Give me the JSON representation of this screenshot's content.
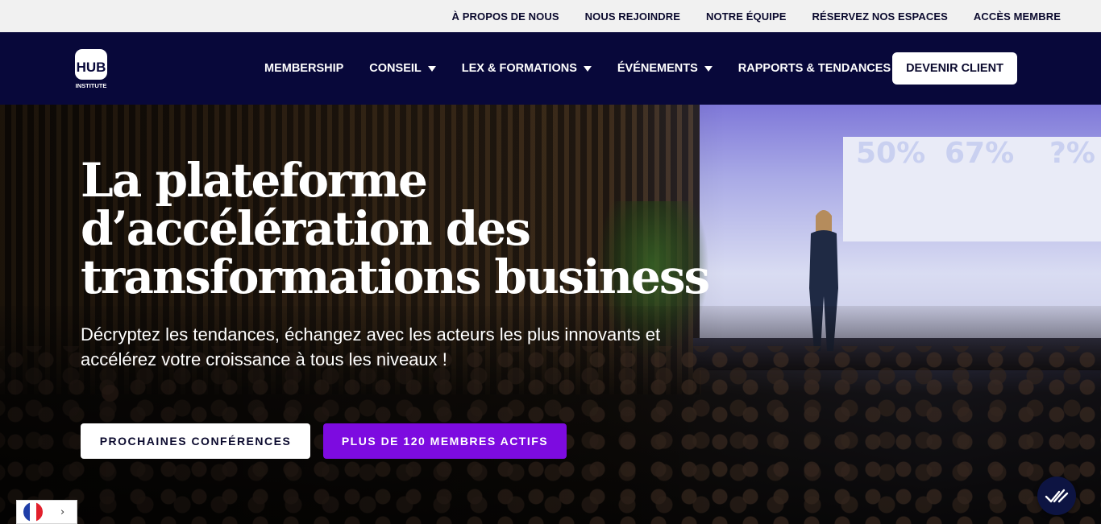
{
  "topbar": {
    "links": [
      "À PROPOS DE NOUS",
      "NOUS REJOINDRE",
      "NOTRE ÉQUIPE",
      "RÉSERVEZ NOS ESPACES",
      "ACCÈS MEMBRE"
    ]
  },
  "logo": {
    "text": "HUB",
    "subtext": "INSTITUTE",
    "icon": "hub-institute-logo"
  },
  "nav": {
    "items": [
      {
        "label": "MEMBERSHIP",
        "dropdown": false
      },
      {
        "label": "CONSEIL",
        "dropdown": true
      },
      {
        "label": "LEX & FORMATIONS",
        "dropdown": true
      },
      {
        "label": "ÉVÉNEMENTS",
        "dropdown": true
      },
      {
        "label": "RAPPORTS & TENDANCES",
        "dropdown": true
      }
    ],
    "cta": "DEVENIR CLIENT"
  },
  "hero": {
    "headline_line1": "La plateforme",
    "headline_line2": "d’accélération des",
    "headline_line3": "transformations business",
    "subline": "Décryptez les tendances, échangez avec les acteurs les plus innovants et accélérez votre croissance à tous les niveaux !",
    "screen_stats": [
      "50%",
      "67%",
      "?%"
    ],
    "button_primary": "PROCHAINES CONFÉRENCES",
    "button_secondary": "PLUS DE 120 MEMBRES ACTIFS"
  },
  "language": {
    "flag": "france-flag-icon",
    "chevron": "›"
  },
  "colors": {
    "navy": "#08083a",
    "purple": "#7d0be0",
    "topbar_bg": "#f1f1f1"
  }
}
